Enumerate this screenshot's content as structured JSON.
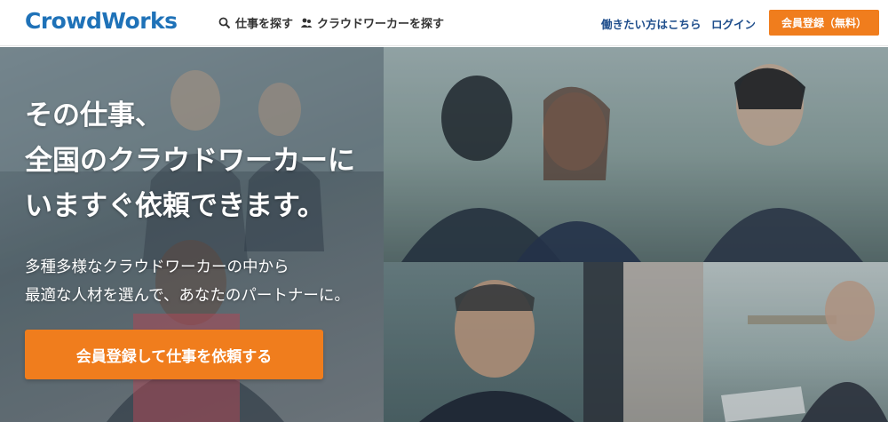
{
  "header": {
    "logo": "CrowdWorks",
    "nav": {
      "search_jobs": "仕事を探す",
      "search_workers": "クラウドワーカーを探す",
      "for_workers": "働きたい方はこちら",
      "login": "ログイン",
      "register": "会員登録（無料）"
    }
  },
  "hero": {
    "headline": [
      "その仕事、",
      "全国のクラウドワーカーに",
      "いますぐ依頼できます。"
    ],
    "subtext": [
      "多種多様なクラウドワーカーの中から",
      "最適な人材を選んで、あなたのパートナーに。"
    ],
    "cta": "会員登録して仕事を依頼する"
  },
  "colors": {
    "brand_blue": "#1f72b8",
    "nav_blue": "#1f4e8c",
    "accent_orange": "#f07d1d"
  },
  "icons": {
    "search": "search-icon",
    "users": "users-icon"
  }
}
